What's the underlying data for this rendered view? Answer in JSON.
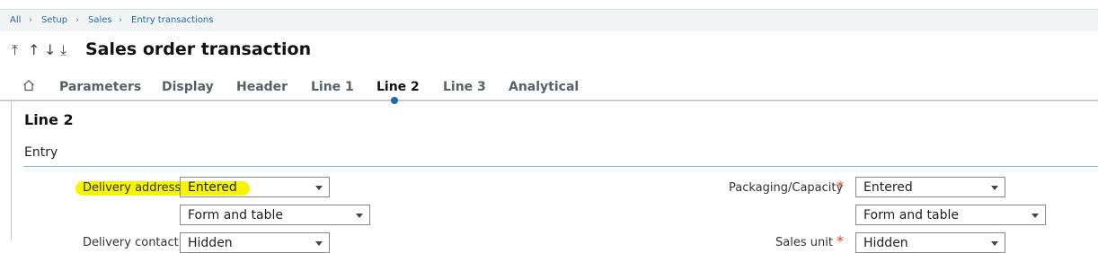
{
  "breadcrumb": {
    "items": [
      "All",
      "Setup",
      "Sales",
      "Entry transactions"
    ]
  },
  "header": {
    "title": "Sales order transaction"
  },
  "tabs": [
    "Parameters",
    "Display",
    "Header",
    "Line 1",
    "Line 2",
    "Line 3",
    "Analytical"
  ],
  "active_tab": "Line 2",
  "section": {
    "title": "Line 2",
    "subtitle": "Entry"
  },
  "fields": {
    "delivery_address": {
      "label": "Delivery address",
      "value": "Entered",
      "display": "Form and table"
    },
    "packaging": {
      "label": "Packaging/Capacity",
      "value": "Entered",
      "display": "Form and table"
    },
    "delivery_contact": {
      "label": "Delivery contact",
      "value": "Hidden"
    },
    "sales_unit": {
      "label": "Sales unit",
      "value": "Hidden"
    }
  },
  "colors": {
    "link": "#1e6aa8",
    "active_dot": "#1e6aa8",
    "required": "#e0452e",
    "highlight": "#f6f500"
  },
  "icons": {
    "home": "home-icon",
    "separator": "chevron-right-icon"
  }
}
